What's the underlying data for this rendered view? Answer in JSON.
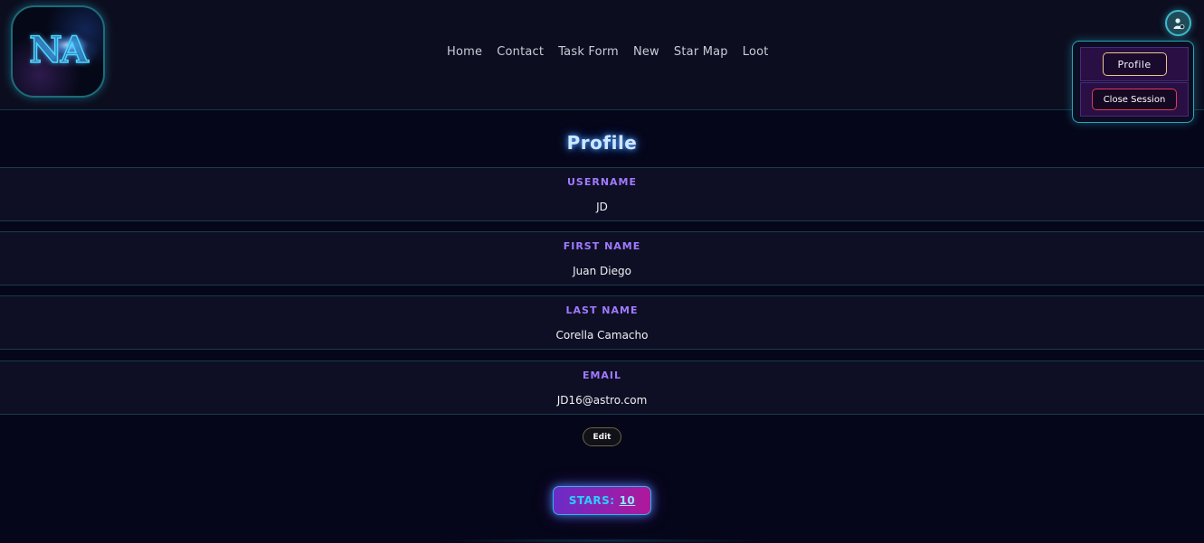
{
  "logo": {
    "text": "NA"
  },
  "nav": {
    "items": [
      {
        "label": "Home"
      },
      {
        "label": "Contact"
      },
      {
        "label": "Task Form"
      },
      {
        "label": "New"
      },
      {
        "label": "Star Map"
      },
      {
        "label": "Loot"
      }
    ]
  },
  "user_menu": {
    "icon": "user-icon",
    "profile_label": "Profile",
    "close_label": "Close Session"
  },
  "page": {
    "title": "Profile",
    "fields": [
      {
        "label": "USERNAME",
        "value": "JD"
      },
      {
        "label": "FIRST NAME",
        "value": "Juan Diego"
      },
      {
        "label": "LAST NAME",
        "value": "Corella Camacho"
      },
      {
        "label": "EMAIL",
        "value": "JD16@astro.com"
      }
    ],
    "edit_label": "Edit",
    "stars": {
      "label": "STARS:",
      "count": "10"
    }
  },
  "colors": {
    "accent_purple": "#a07aff",
    "accent_cyan": "#2ad0ff",
    "danger": "#e03a58",
    "background": "#06061a"
  }
}
